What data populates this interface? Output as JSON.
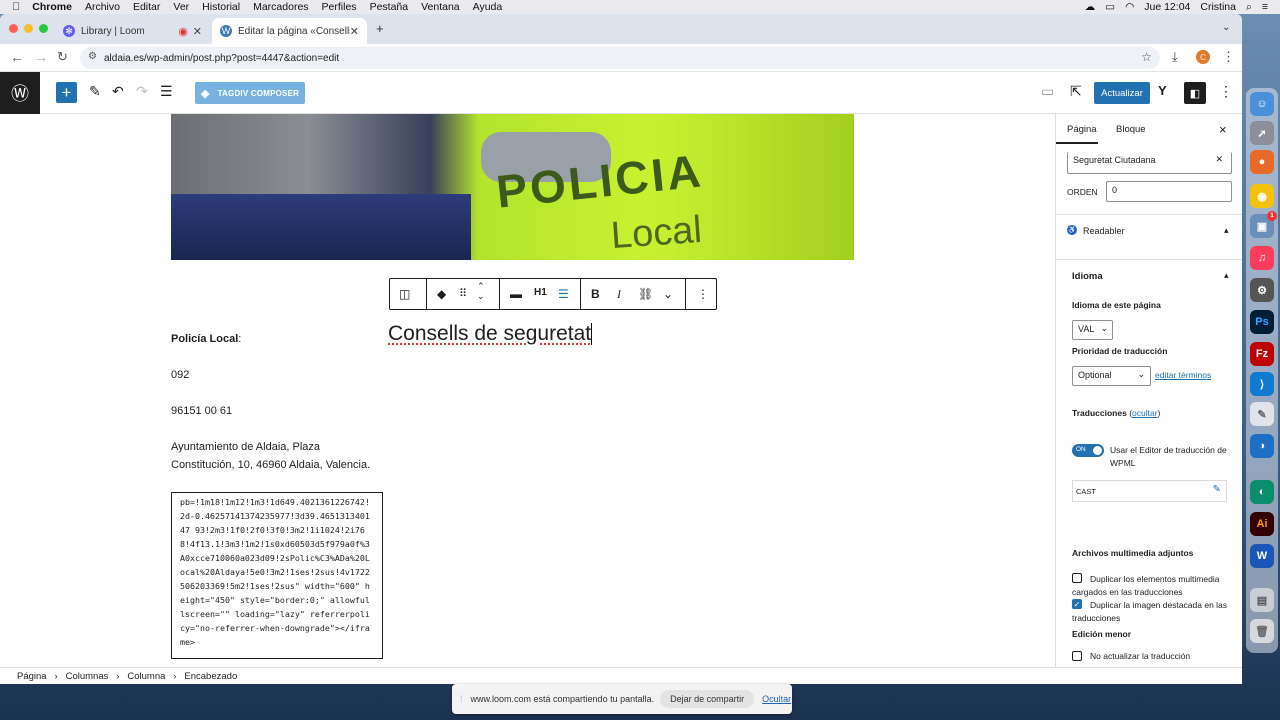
{
  "menubar": {
    "items": [
      "Chrome",
      "Archivo",
      "Editar",
      "Ver",
      "Historial",
      "Marcadores",
      "Perfiles",
      "Pestaña",
      "Ventana",
      "Ayuda"
    ],
    "clock": "Jue 12:04",
    "user": "Cristina"
  },
  "browser": {
    "tabs": [
      {
        "title": "Library | Loom"
      },
      {
        "title": "Editar la página «Consells de"
      }
    ],
    "new_tab": "+",
    "url": "aldaia.es/wp-admin/post.php?post=4447&action=edit",
    "profile_initial": "C"
  },
  "wp_toolbar": {
    "tagdiv_label": "TAGDIV COMPOSER",
    "update_label": "Actualizar"
  },
  "block_toolbar": {
    "heading_level": "H1",
    "bold": "B",
    "italic": "I"
  },
  "content": {
    "heading": "Consells de seguretat",
    "police_label": "Policía Local",
    "police_colon": ":",
    "phone1": "092",
    "phone2": "96151 00 61",
    "address_line1": "Ayuntamiento de Aldaia, Plaza",
    "address_line2": "Constitución, 10, 46960 Aldaia, Valencia.",
    "code": "pb=!1m18!1m12!1m3!1d649.4021361226742!2d-0.46257141374235977!3d39.465131340147 93!2m3!1f0!2f0!3f0!3m2!1i1024!2i768!4f13.1!3m3!1m2!1s0xd60503d5f979a0f%3A0xcce710060a023d09!2sPolic%C3%ADa%20Local%20Aldaya!5e0!3m2!1ses!2sus!4v1722506203369!5m2!1ses!2sus\" width=\"600\" height=\"450\" style=\"border:0;\" allowfullscreen=\"\" loading=\"lazy\" referrerpolicy=\"no-referrer-when-downgrade\"></iframe>"
  },
  "hero_image": {
    "text_line1": "POLICIA",
    "text_line2": "Local"
  },
  "sidebar": {
    "tab_page": "Página",
    "tab_block": "Bloque",
    "close": "×",
    "category_value": "Seguretat Ciutadana",
    "order_label": "ORDEN",
    "order_value": "0",
    "readabler_label": "Readabler",
    "idioma_label": "Idioma",
    "page_lang_label": "Idioma de este página",
    "page_lang_value": "VAL",
    "priority_label": "Prioridad de traducción",
    "priority_value": "Optional",
    "edit_terms": "editar términos",
    "translations_label": "Traducciones",
    "translations_hide": "ocultar",
    "toggle_state": "ON",
    "wpml_label": "Usar el Editor de traducción de WPML",
    "cast_label": "CAST",
    "media_label": "Archivos multimedia adjuntos",
    "dup_media": "Duplicar los elementos multimedia cargados en las traducciones",
    "dup_featured": "Duplicar la imagen destacada en las traducciones",
    "minor_label": "Edición menor",
    "no_update": "No actualizar la traducción"
  },
  "breadcrumb": [
    "Página",
    "Columnas",
    "Columna",
    "Encabezado"
  ],
  "loom_banner": {
    "message": "www.loom.com está compartiendo tu pantalla.",
    "stop": "Dejar de compartir",
    "hide": "Ocultar"
  },
  "dock": {
    "ps": "Ps",
    "fz": "Fz",
    "ai": "Ai",
    "w": "W",
    "badge": "1"
  },
  "colors": {
    "wp_blue": "#2271b1",
    "tagdiv": "#76b3e0",
    "wp_dark": "#1e1e1e"
  }
}
